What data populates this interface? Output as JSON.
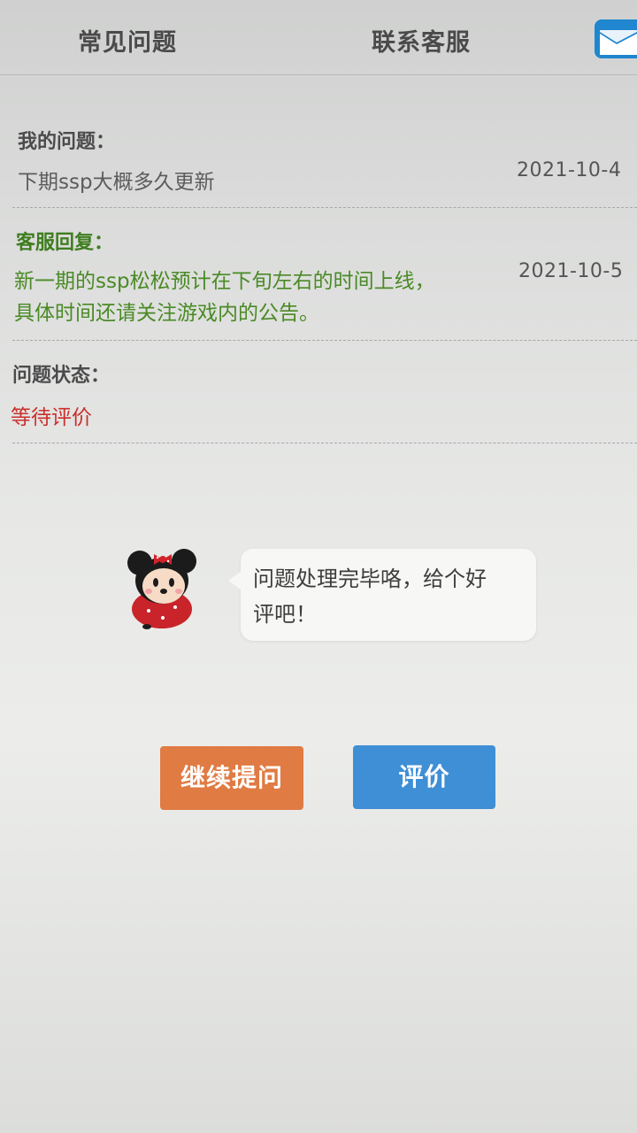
{
  "header": {
    "tabs": [
      {
        "label": "常见问题"
      },
      {
        "label": "联系客服"
      }
    ],
    "mail_icon": "envelope-icon",
    "accent_color": "#1f86cf"
  },
  "question": {
    "label": "我的问题：",
    "text": "下期ssp大概多久更新",
    "date": "2021-10-4"
  },
  "reply": {
    "label": "客服回复：",
    "lines": [
      "新一期的ssp松松预计在下旬左右的时间上线，",
      "具体时间还请关注游戏内的公告。"
    ],
    "date": "2021-10-5",
    "color": "#4a8a25"
  },
  "status": {
    "label": "问题状态：",
    "value": "等待评价",
    "color": "#c9302c"
  },
  "prompt": {
    "mascot_icon": "minnie-mascot-icon",
    "lines": [
      "问题处理完毕咯，给个好",
      "评吧！"
    ]
  },
  "actions": {
    "continue_label": "继续提问",
    "continue_color": "#e07b43",
    "rate_label": "评价",
    "rate_color": "#3f8fd6"
  }
}
